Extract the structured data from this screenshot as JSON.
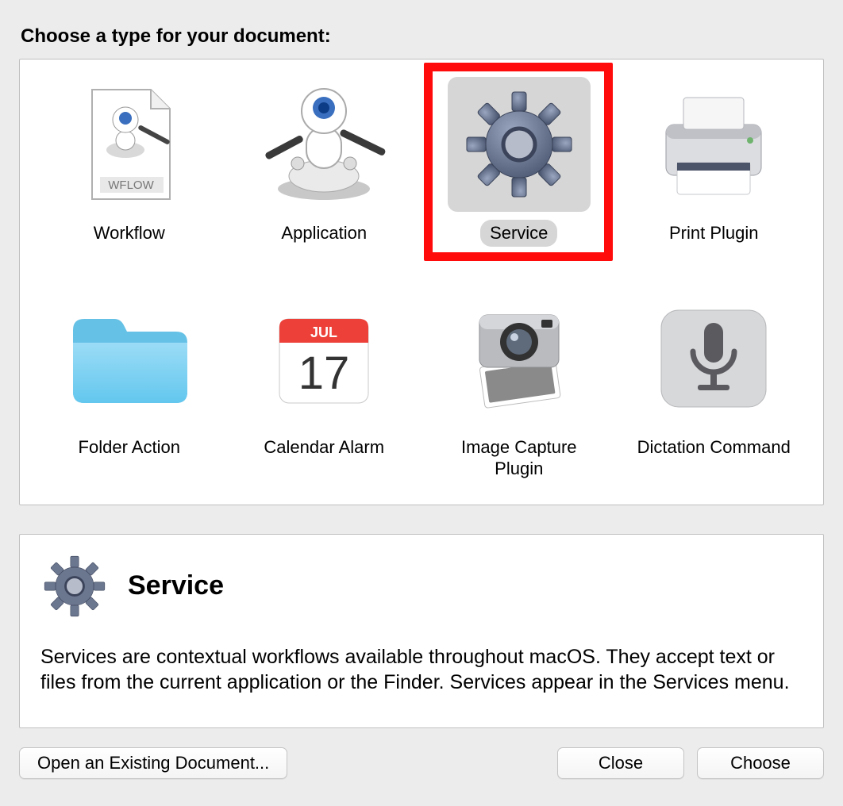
{
  "heading": "Choose a type for your document:",
  "types": [
    {
      "id": "workflow",
      "label": "Workflow",
      "icon": "workflow",
      "selected": false
    },
    {
      "id": "application",
      "label": "Application",
      "icon": "app",
      "selected": false
    },
    {
      "id": "service",
      "label": "Service",
      "icon": "gear",
      "selected": true
    },
    {
      "id": "print",
      "label": "Print Plugin",
      "icon": "printer",
      "selected": false
    },
    {
      "id": "folder",
      "label": "Folder Action",
      "icon": "folder",
      "selected": false
    },
    {
      "id": "calendar",
      "label": "Calendar Alarm",
      "icon": "calendar",
      "selected": false,
      "calendar_month": "JUL",
      "calendar_day": "17"
    },
    {
      "id": "imgcap",
      "label": "Image Capture Plugin",
      "icon": "camera",
      "selected": false
    },
    {
      "id": "dictation",
      "label": "Dictation Command",
      "icon": "mic",
      "selected": false
    }
  ],
  "highlighted_type_id": "service",
  "description": {
    "icon": "gear",
    "title": "Service",
    "body": "Services are contextual workflows available throughout macOS. They accept text or files from the current application or the Finder. Services appear in the Services menu."
  },
  "buttons": {
    "open_existing": "Open an Existing Document...",
    "close": "Close",
    "choose": "Choose"
  },
  "workflow_doc_label": "WFLOW"
}
